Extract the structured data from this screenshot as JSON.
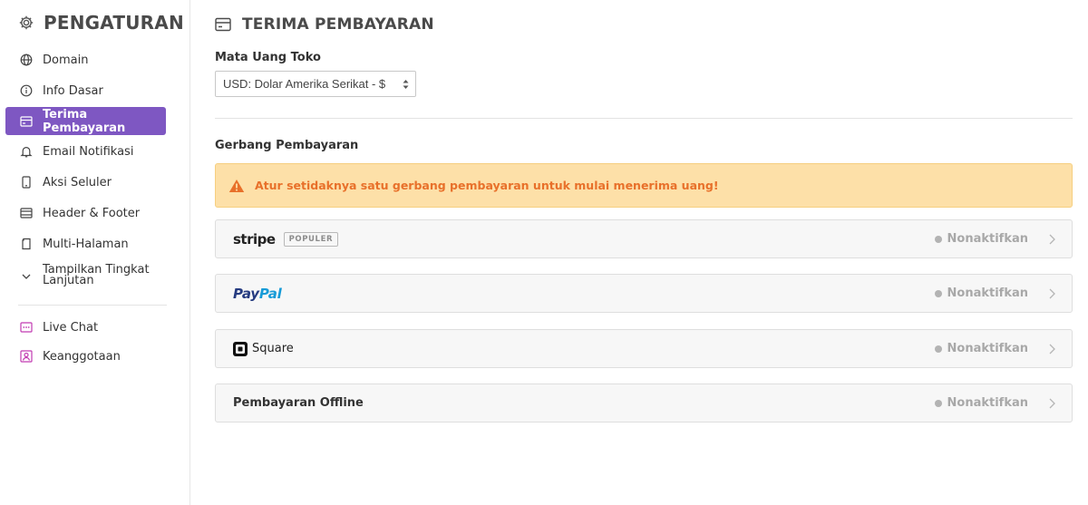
{
  "sidebar": {
    "title": "PENGATURAN",
    "items": [
      {
        "label": "Domain",
        "icon": "globe-icon"
      },
      {
        "label": "Info Dasar",
        "icon": "info-icon"
      },
      {
        "label": "Terima Pembayaran",
        "icon": "payment-card-icon",
        "active": true
      },
      {
        "label": "Email Notifikasi",
        "icon": "bell-icon"
      },
      {
        "label": "Aksi Seluler",
        "icon": "mobile-icon"
      },
      {
        "label": "Header & Footer",
        "icon": "layout-icon"
      },
      {
        "label": "Multi-Halaman",
        "icon": "pages-icon"
      },
      {
        "label": "Tampilkan Tingkat Lanjutan",
        "label_line1": "Tampilkan Tingkat",
        "label_line2": "Lanjutan",
        "icon": "chevron-down-icon"
      }
    ],
    "extras": [
      {
        "label": "Live Chat",
        "icon": "chat-icon"
      },
      {
        "label": "Keanggotaan",
        "icon": "member-icon"
      }
    ]
  },
  "main": {
    "title": "TERIMA PEMBAYARAN",
    "currency": {
      "label": "Mata Uang Toko",
      "selected": "USD: Dolar Amerika Serikat - $"
    },
    "gateways": {
      "label": "Gerbang Pembayaran",
      "warning": "Atur setidaknya satu gerbang pembayaran untuk mulai menerima uang!",
      "items": [
        {
          "name": "stripe",
          "badge": "POPULER",
          "status": "Nonaktifkan"
        },
        {
          "name": "PayPal",
          "name_part1": "Pay",
          "name_part2": "Pal",
          "status": "Nonaktifkan"
        },
        {
          "name": "Square",
          "status": "Nonaktifkan"
        },
        {
          "name": "Pembayaran Offline",
          "status": "Nonaktifkan"
        }
      ]
    }
  },
  "colors": {
    "accent": "#7e57c2",
    "warning_bg": "#fde0a8",
    "warning_text": "#e8702a",
    "paypal_dark": "#253b80",
    "paypal_light": "#179bd7",
    "extras_icon": "#c23bb2"
  }
}
